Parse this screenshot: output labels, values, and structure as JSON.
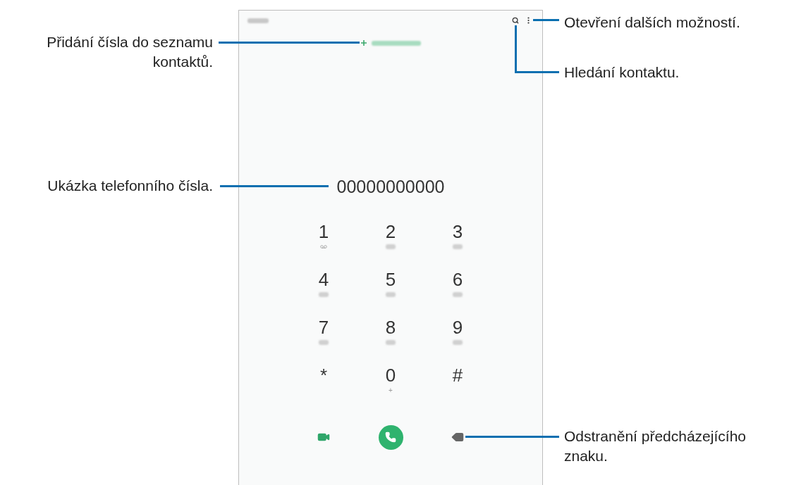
{
  "left_callouts": [
    {
      "lines": [
        "Přidání čísla do seznamu",
        "kontaktů."
      ]
    },
    {
      "lines": [
        "Ukázka telefonního čísla."
      ]
    }
  ],
  "right_callouts": [
    {
      "lines": [
        "Otevření dalších možností."
      ]
    },
    {
      "lines": [
        "Hledání kontaktu."
      ]
    },
    {
      "lines": [
        "Odstranění předcházejícího",
        "znaku."
      ]
    }
  ],
  "phone": {
    "number": "00000000000",
    "keys": [
      {
        "digit": "1",
        "kind": "voicemail"
      },
      {
        "digit": "2",
        "kind": "blurred"
      },
      {
        "digit": "3",
        "kind": "blurred"
      },
      {
        "digit": "4",
        "kind": "blurred"
      },
      {
        "digit": "5",
        "kind": "blurred"
      },
      {
        "digit": "6",
        "kind": "blurred"
      },
      {
        "digit": "7",
        "kind": "blurred"
      },
      {
        "digit": "8",
        "kind": "blurred"
      },
      {
        "digit": "9",
        "kind": "blurred"
      },
      {
        "digit": "*",
        "kind": "none"
      },
      {
        "digit": "0",
        "kind": "text",
        "sub": "+"
      },
      {
        "digit": "#",
        "kind": "none"
      }
    ]
  }
}
